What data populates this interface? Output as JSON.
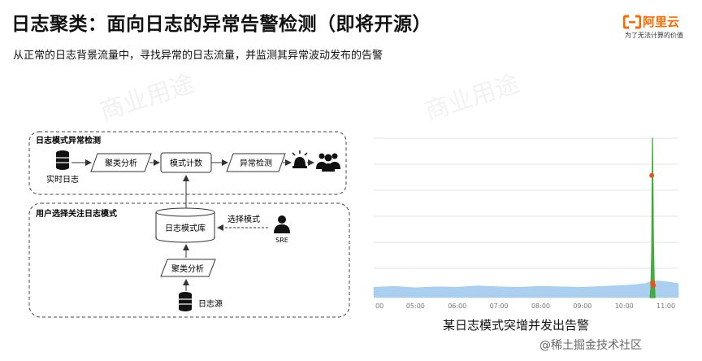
{
  "header": {
    "title": "日志聚类：面向日志的异常告警检测（即将开源）",
    "subtitle": "从正常的日志背景流量中，寻找异常的日志流量，并监测其异常波动发布的告警"
  },
  "logo": {
    "brand": "阿里云",
    "slogan": "为了无法计算的价值",
    "color": "#ff6a00"
  },
  "watermark": "商业用途",
  "diagram": {
    "top_group_label": "日志模式异常检测",
    "bottom_group_label": "用户选择关注日志模式",
    "nodes": {
      "realtime_log": "实时日志",
      "cluster_top": "聚类分析",
      "pattern_count": "模式计数",
      "anomaly_detect": "异常检测",
      "pattern_db": "日志模式库",
      "select_label": "选择模式",
      "sre": "SRE",
      "cluster_bottom": "聚类分析",
      "log_source": "日志源"
    }
  },
  "chart_data": {
    "type": "area",
    "x_ticks": [
      "00",
      "05:00",
      "06:00",
      "07:00",
      "08:00",
      "09:00",
      "10:00",
      "11:00"
    ],
    "caption": "某日志模式突增并发出告警",
    "series": [
      {
        "name": "",
        "color": "#9cc7ec",
        "x": [
          4.0,
          4.5,
          5.0,
          5.5,
          6.0,
          6.5,
          7.0,
          7.5,
          8.0,
          8.5,
          9.0,
          9.5,
          10.0,
          10.3,
          10.5,
          10.7,
          11.0,
          11.3
        ],
        "y": [
          2.2,
          2.4,
          2.1,
          2.3,
          2.2,
          2.5,
          2.3,
          2.2,
          2.4,
          2.3,
          2.2,
          2.4,
          2.6,
          2.8,
          3.0,
          3.6,
          3.4,
          3.0
        ]
      },
      {
        "name": "",
        "color": "#3aa735",
        "x": [
          10.62,
          10.64,
          10.66,
          10.68,
          10.7,
          10.72,
          10.74
        ],
        "y": [
          0,
          2,
          10,
          34,
          12,
          3,
          0
        ]
      }
    ],
    "alert_points": [
      {
        "x": 10.66,
        "y": 26
      },
      {
        "x": 10.68,
        "y": 3.2
      },
      {
        "x": 10.7,
        "y": 2.6
      }
    ],
    "xlim": [
      4.0,
      11.3
    ],
    "ylim": [
      0,
      36
    ],
    "grid": true
  },
  "credit": "@稀土掘金技术社区"
}
